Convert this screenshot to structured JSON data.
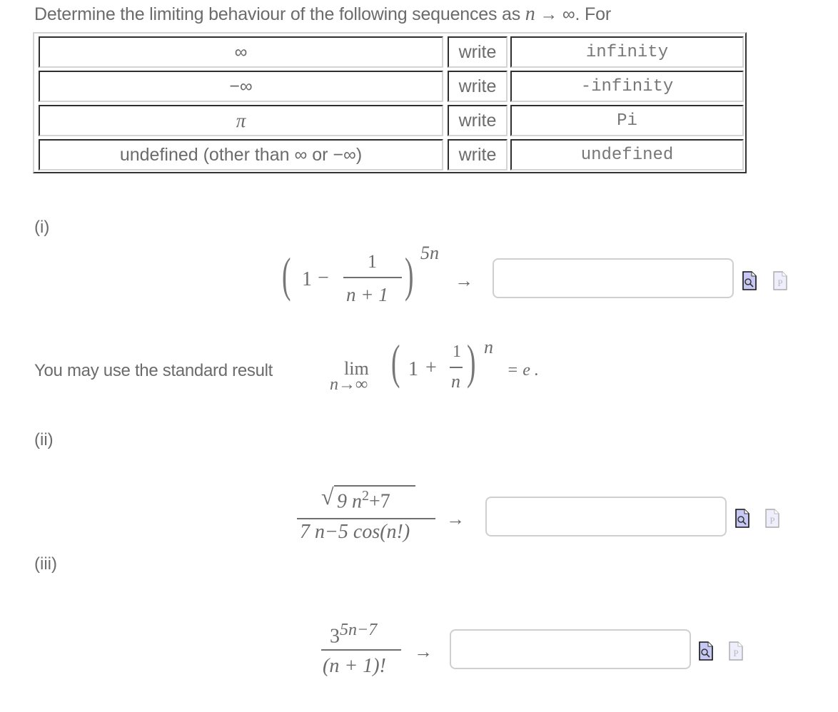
{
  "intro": {
    "text_before": "Determine the limiting behaviour of the following sequences as ",
    "var": "n",
    "arrow": "→",
    "infinity": "∞",
    "text_after": ". For"
  },
  "table": {
    "rows": [
      {
        "symbol": "∞",
        "verb": "write",
        "code": "infinity"
      },
      {
        "symbol": "−∞",
        "verb": "write",
        "code": "-infinity"
      },
      {
        "symbol": "π",
        "verb": "write",
        "code": "Pi"
      },
      {
        "symbol": "undefined (other than ∞ or −∞)",
        "verb": "write",
        "code": "undefined"
      }
    ]
  },
  "parts": [
    {
      "label": "(i)",
      "expression": "(1 − 1/(n+1))^(5n)",
      "answer_value": "",
      "answer_placeholder": ""
    },
    {
      "label": "(ii)",
      "expression": "√(9n²+7) / (7n − 5 cos(n!))",
      "answer_value": "",
      "answer_placeholder": ""
    },
    {
      "label": "(iii)",
      "expression": "3^(5n−7) / (n+1)!",
      "answer_value": "",
      "answer_placeholder": ""
    }
  ],
  "hint": {
    "text": "You may use the standard result",
    "lim": "lim",
    "lim_sub": "n→∞",
    "result": "= e ."
  },
  "math": {
    "one": "1",
    "minus": "−",
    "plus": "+",
    "n": "n",
    "n_plus_1": "n + 1",
    "exp_5n": "5n",
    "arrow": "→",
    "sqrt_arg": "9 n",
    "sq": "2",
    "plus7": "+7",
    "denom2": "7 n−5 cos(n!)",
    "base3": "3",
    "exp3": "5n−7",
    "denom3": "(n + 1)!"
  },
  "icons": {
    "preview": "preview-icon",
    "paper": "paper-icon"
  },
  "colors": {
    "text": "#6b6b6b",
    "preview_fill": "#c8c8f5",
    "paper_fill": "#eeeefc"
  }
}
